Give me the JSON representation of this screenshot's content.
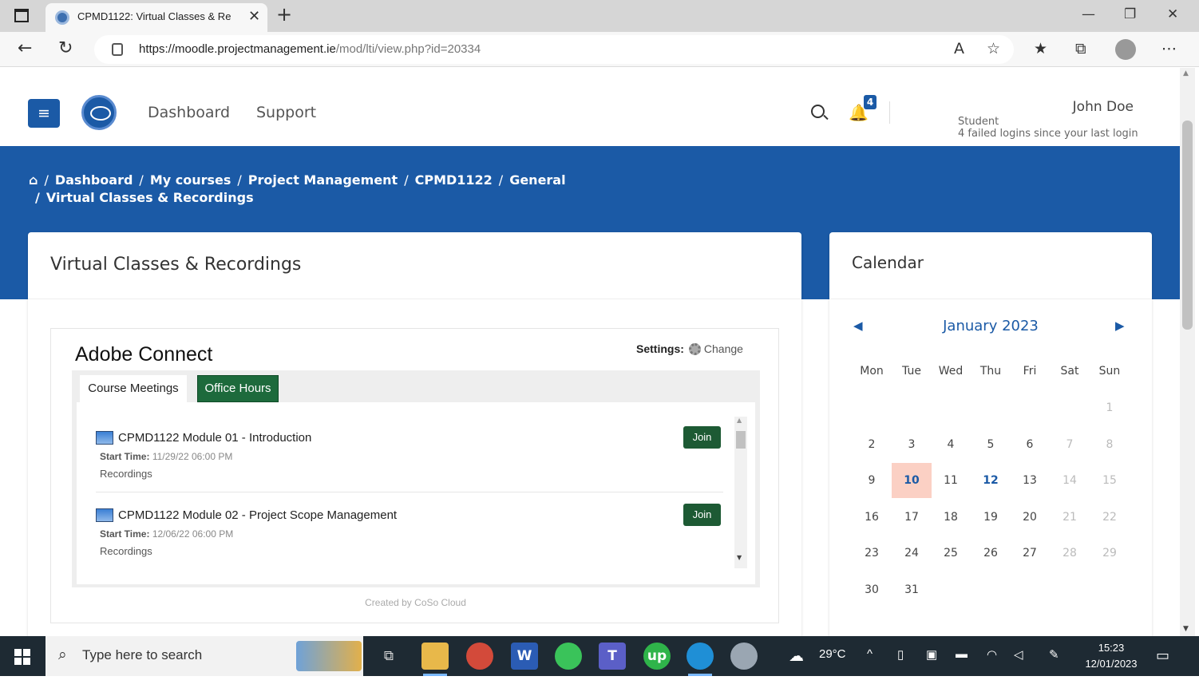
{
  "browser": {
    "tab_title": "CPMD1122: Virtual Classes & Re",
    "tab_close": "✕",
    "new_tab": "+",
    "url_host": "https://moodle.projectmanagement.ie",
    "url_path": "/mod/lti/view.php?id=20334",
    "window_controls": [
      "—",
      "❐",
      "✕"
    ]
  },
  "navbar": {
    "menu_glyph": "≡",
    "links": [
      "Dashboard",
      "Support"
    ],
    "notification_count": "4",
    "user_name": "John Doe",
    "user_role": "Student",
    "login_notice": "4 failed logins since your last login"
  },
  "breadcrumb": {
    "items": [
      "Dashboard",
      "My courses",
      "Project Management",
      "CPMD1122",
      "General"
    ],
    "current": "Virtual Classes & Recordings",
    "separator": "/"
  },
  "main": {
    "title": "Virtual Classes & Recordings",
    "adobe": {
      "title": "Adobe Connect",
      "settings_label": "Settings:",
      "change_label": "Change",
      "tabs": [
        "Course Meetings",
        "Office Hours"
      ],
      "start_time_label": "Start Time:",
      "recordings_label": "Recordings",
      "join_label": "Join",
      "meetings": [
        {
          "name": "CPMD1122 Module 01 - Introduction",
          "start": "11/29/22 06:00 PM"
        },
        {
          "name": "CPMD1122 Module 02 - Project Scope Management",
          "start": "12/06/22 06:00 PM"
        }
      ],
      "footer_prefix": "Created by",
      "footer_brand": "CoSo Cloud"
    }
  },
  "calendar": {
    "title": "Calendar",
    "month": "January 2023",
    "weekdays": [
      "Mon",
      "Tue",
      "Wed",
      "Thu",
      "Fri",
      "Sat",
      "Sun"
    ],
    "first_weekday_index": 6,
    "days_in_month": 31,
    "today": 10,
    "event_days": [
      12
    ],
    "accent": "#1b5aa6",
    "today_bg": "#fbd0c4"
  },
  "taskbar": {
    "search_placeholder": "Type here to search",
    "weather": "29°C",
    "time": "15:23",
    "date": "12/01/2023",
    "apps": [
      "task-view",
      "file-explorer",
      "chrome",
      "word",
      "whatsapp",
      "teams",
      "upwork",
      "edge",
      "paint"
    ]
  },
  "colors": {
    "brand_blue": "#1b5aa6",
    "join_green": "#1d5a34",
    "office_hours_green": "#1d6a3c"
  }
}
